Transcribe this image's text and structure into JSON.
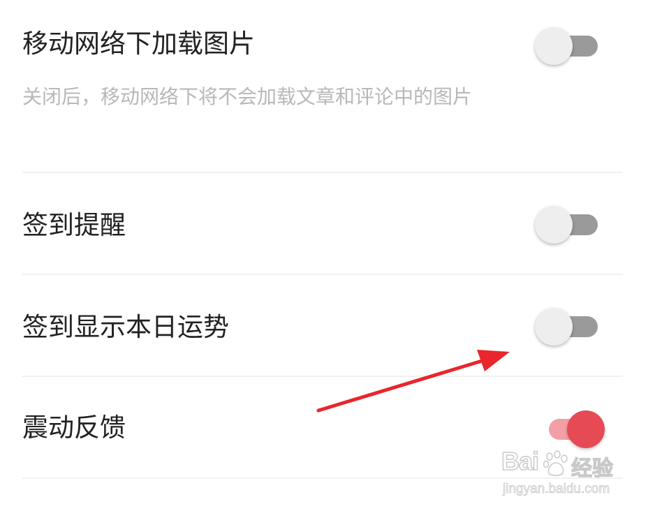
{
  "settings": {
    "items": [
      {
        "title": "移动网络下加载图片",
        "description": "关闭后，移动网络下将不会加载文章和评论中的图片",
        "enabled": false
      },
      {
        "title": "签到提醒",
        "enabled": false
      },
      {
        "title": "签到显示本日运势",
        "enabled": false
      },
      {
        "title": "震动反馈",
        "enabled": true
      }
    ]
  },
  "colors": {
    "toggle_on_knob": "#e64a55",
    "toggle_on_track": "#f2a0a6",
    "toggle_off_knob": "#eeeeee",
    "toggle_off_track": "#9a9a9a",
    "annotation_arrow": "#e8262c"
  },
  "watermark": {
    "brand": "Bai",
    "brand_suffix": "经验",
    "url": "jingyan.baidu.com"
  }
}
